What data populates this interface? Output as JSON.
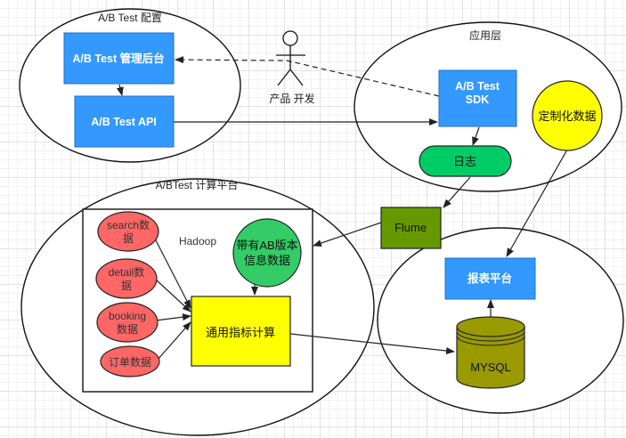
{
  "colors": {
    "blue_box": "#3399ff",
    "green_pill": "#00cc66",
    "olive_box": "#669900",
    "yellow": "#ffff00",
    "red_node": "#ff6666",
    "green_circle": "#33cc66",
    "cylinder": "#999900"
  },
  "groups": {
    "ab_config": "A/B Test 配置",
    "app_layer": "应用层",
    "compute_platform": "A/BTest  计算平台"
  },
  "actor": {
    "label": "产品 开发",
    "icon": "stick-figure-actor-icon"
  },
  "nodes": {
    "admin": "A/B Test 管理后台",
    "api": "A/B Test API",
    "sdk_line1": "A/B Test",
    "sdk_line2": "SDK",
    "custom_data": "定制化数据",
    "log": "日志",
    "flume": "Flume",
    "hadoop": "Hadoop",
    "search_line1": "search数",
    "search_line2": "据",
    "detail_line1": "detail数",
    "detail_line2": "据",
    "booking_line1": "booking",
    "booking_line2": "数据",
    "order": "订单数据",
    "ab_info_line1": "带有AB版本",
    "ab_info_line2": "信息数据",
    "metric_calc": "通用指标计算",
    "report": "报表平台",
    "mysql": "MYSQL"
  }
}
